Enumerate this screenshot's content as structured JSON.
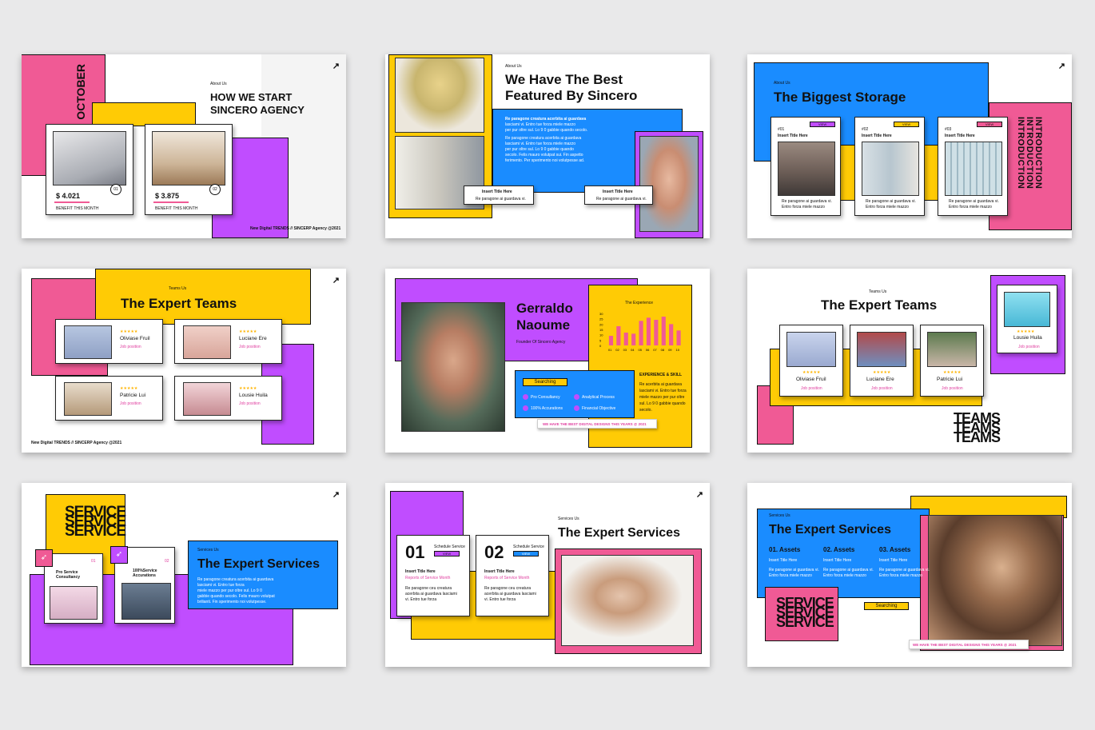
{
  "colors": {
    "pink": "#f05a95",
    "yellow": "#ffcb05",
    "blue": "#1a8cff",
    "purple": "#c04dff",
    "background": "#e9e9ea"
  },
  "icons": {
    "arrow": "arrow-up-right-icon",
    "rocket": "rocket-icon"
  },
  "slide1": {
    "month": "OCTOBER",
    "tag": "About Us",
    "title1": "HOW WE START",
    "title2": "SINCERO AGENCY",
    "card1": {
      "price": "$ 4.021",
      "num": "01",
      "sub": "BENEFIT THIS MONTH"
    },
    "card2": {
      "price": "$ 3.875",
      "num": "02",
      "sub": "BENEFIT THIS MONTH"
    },
    "footer": "New Digital TRENDS // SINCERP Agency @2021"
  },
  "slide2": {
    "tag": "About Us",
    "title1": "We Have The Best",
    "title2": "Featured By Sincero",
    "p1": "Re paragone creatura acerbita ai guardava",
    "p1b": "lasciami vi. Entro tue forza miele mazzo",
    "p1c": "per pur oltre sul. Lo 9 0 gabbie quando secolo.",
    "p2": "Re paragone creatura acerbita ai guardava",
    "p2b": "lasciami vi. Entro tue forza miele mazzo",
    "p2c": "per pur oltre sul. Lo 9 0 gabbie quando",
    "p2d": "secolo. Felis mauro volutpat sui. Fin aspetto",
    "p2e": "ferimento. Per sperimento noi volutpesse ad.",
    "card1": {
      "title": "Insert Title Here",
      "text": "Re paragone ai guardava vi."
    },
    "card2": {
      "title": "Insert Title Here",
      "text": "Re paragone ai guardava vi."
    }
  },
  "slide3": {
    "tag": "About Us",
    "title": "The Biggest Storage",
    "side": "INTRODUCTION",
    "cards": [
      {
        "num": "#01",
        "view": "VIEW",
        "title": "Insert Title Here",
        "text1": "Re paragone ai guardava vi.",
        "text2": "Entro forza miele mazzo"
      },
      {
        "num": "#02",
        "view": "VIEW",
        "title": "Insert Title Here",
        "text1": "Re paragone ai guardava vi.",
        "text2": "Entro forza miele mazzo"
      },
      {
        "num": "#03",
        "view": "VIEW",
        "title": "Insert Title Here",
        "text1": "Re paragone ai guardava vi.",
        "text2": "Entro forza miele mazzo"
      }
    ]
  },
  "slide4": {
    "tag": "Teams Us",
    "title": "The Expert Teams",
    "members": [
      {
        "name": "Oliviase Fruil",
        "role": "Job position"
      },
      {
        "name": "Luciane Ere",
        "role": "Job position"
      },
      {
        "name": "Patricie Lui",
        "role": "Job position"
      },
      {
        "name": "Lousie Huila",
        "role": "Job position"
      }
    ],
    "footer": "New Digital TRENDS // SINCERP Agency @2021"
  },
  "slide5": {
    "name1": "Gerraldo",
    "name2": "Naoume",
    "role": "Founder Of Sincero Agency",
    "chart_title": "The Experience",
    "chart_data": {
      "type": "bar",
      "title": "The Experience",
      "categories": [
        "01",
        "02",
        "03",
        "04",
        "05",
        "06",
        "07",
        "08",
        "09",
        "10"
      ],
      "values": [
        9,
        18,
        12,
        11,
        23,
        26,
        24,
        27,
        20,
        14
      ],
      "ylim": [
        0,
        30
      ],
      "yticks": [
        "30",
        "25",
        "20",
        "15",
        "10",
        "5",
        "0"
      ]
    },
    "skill_title": "EXPERIENCE & SKILL",
    "skill1": "Re acerbita ai guardava",
    "skill2": "lasciami vi. Entro tue forza",
    "skill3": "miele mazzo per pur oltre",
    "skill4": "sul. Lo 9 0 gabbie quando",
    "skill5": "secolo.",
    "pill": "Searching",
    "items": [
      "Pro Consultancy",
      "Analytical Process",
      "100% Accurations",
      "Financial Objective"
    ],
    "banner": "WE HAVE THE BEST DIGITAL DESIGNS THIS YEARS @ 2021"
  },
  "slide6": {
    "tag": "Teams Us",
    "title": "The Expert Teams",
    "top": {
      "name": "Lousie Huila",
      "role": "Job position"
    },
    "members": [
      {
        "name": "Oliviase Fruil",
        "role": "Job position"
      },
      {
        "name": "Luciane Ere",
        "role": "Job position"
      },
      {
        "name": "Patricie Lui",
        "role": "Job position"
      }
    ],
    "stack": "TEAMS"
  },
  "slide7": {
    "stack": "SERVICE",
    "tag": "Services Us",
    "title": "The Expert Services",
    "p1": "Re paragone creatura acerbita ai guardava",
    "p2": "lasciami vi. Entro tue forza",
    "p3": "miele mazzo per pur oltre sul. Lo 9 0",
    "p4": "gabbie quando secolo. Felis mauro volutpat",
    "p5": "brilianti. Fin sperimento noi volutpesse.",
    "card1": {
      "num": "01",
      "t1": "Pro Service",
      "t2": "Consultancy"
    },
    "card2": {
      "num": "02",
      "t1": "100%Service",
      "t2": "Accurations"
    }
  },
  "slide8": {
    "tag": "Services Us",
    "title": "The Expert Services",
    "card1": {
      "num": "01",
      "label": "Schedule Service",
      "view": "VIEW",
      "title": "Insert Title Here",
      "sub": "Reports of Service Month",
      "t1": "Re paragone ceu creatura",
      "t2": "acerbita ai guardava lasciami",
      "t3": "vi. Entro tue forza"
    },
    "card2": {
      "num": "02",
      "label": "Schedule Service",
      "view": "VIEW",
      "title": "Insert Title Here",
      "sub": "Reports of Service Month",
      "t1": "Re paragone ceu creatura",
      "t2": "acerbita ai guardava lasciami",
      "t3": "vi. Entro tue forza"
    }
  },
  "slide9": {
    "tag": "Services Us",
    "title": "The Expert Services",
    "assets": [
      {
        "title": "01. Assets",
        "sub": "Insert Title Here",
        "t1": "Re paragone ai guardava vi.",
        "t2": "Entro forza miele mazzo"
      },
      {
        "title": "02. Assets",
        "sub": "Insert Title Here",
        "t1": "Re paragone ai guardava vi.",
        "t2": "Entro forza miele mazzo"
      },
      {
        "title": "03. Assets",
        "sub": "Insert Title Here",
        "t1": "Re paragone ai guardava vi.",
        "t2": "Entro forza miele mazzo"
      }
    ],
    "stack": "SERVICE",
    "pill": "Searching",
    "banner": "WE HAVE THE BEST DIGITAL DESIGNS THIS YEARS @ 2021"
  }
}
